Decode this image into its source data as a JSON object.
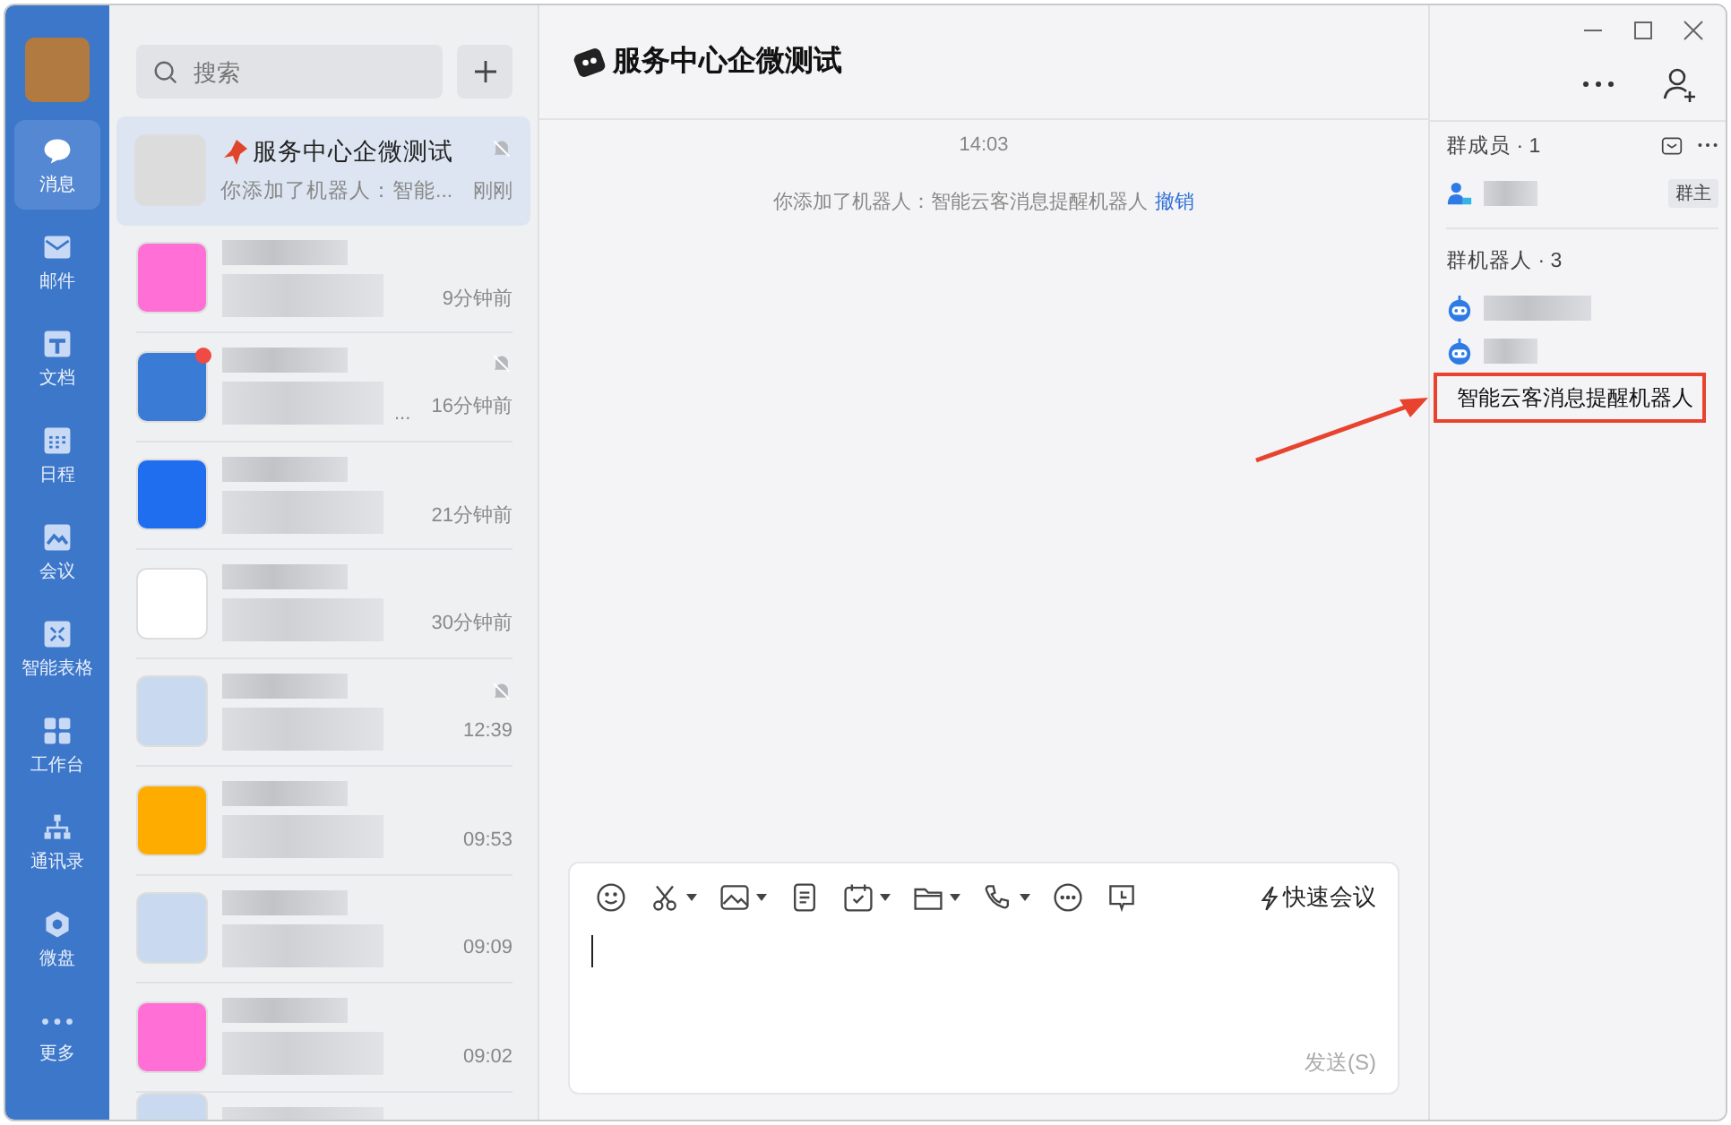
{
  "nav": [
    {
      "label": "消息",
      "selected": true
    },
    {
      "label": "邮件",
      "selected": false
    },
    {
      "label": "文档",
      "selected": false
    },
    {
      "label": "日程",
      "selected": false
    },
    {
      "label": "会议",
      "selected": false
    },
    {
      "label": "智能表格",
      "selected": false
    },
    {
      "label": "工作台",
      "selected": false
    },
    {
      "label": "通讯录",
      "selected": false
    },
    {
      "label": "微盘",
      "selected": false
    },
    {
      "label": "更多",
      "selected": false
    }
  ],
  "search": {
    "placeholder": "搜索"
  },
  "conversations": [
    {
      "title": "服务中心企微测试",
      "preview": "你添加了机器人：智能...",
      "time": "刚刚",
      "muted": true,
      "unread": false,
      "selected": true
    },
    {
      "time": "9分钟前",
      "muted": false,
      "unread": false,
      "selected": false
    },
    {
      "time": "16分钟前",
      "preview_tail": "...",
      "muted": true,
      "unread": true,
      "selected": false
    },
    {
      "time": "21分钟前",
      "muted": false,
      "unread": false,
      "selected": false
    },
    {
      "time": "30分钟前",
      "muted": false,
      "unread": false,
      "selected": false
    },
    {
      "time": "12:39",
      "muted": true,
      "unread": false,
      "selected": false
    },
    {
      "time": "09:53",
      "muted": false,
      "unread": false,
      "selected": false
    },
    {
      "time": "09:09",
      "muted": false,
      "unread": false,
      "selected": false
    },
    {
      "time": "09:02",
      "muted": false,
      "unread": false,
      "selected": false
    }
  ],
  "chat": {
    "title": "服务中心企微测试",
    "time": "14:03",
    "system_message": "你添加了机器人：智能云客消息提醒机器人",
    "undo_link": "撤销",
    "quick_meeting": "快速会议",
    "send": "发送(S)"
  },
  "members": {
    "heading": "群成员 · 1",
    "owner_badge": "群主"
  },
  "robots": {
    "heading": "群机器人 · 3",
    "items": [
      {
        "highlighted": false
      },
      {
        "highlighted": false
      },
      {
        "name": "智能云客消息提醒机器人",
        "highlighted": true
      }
    ]
  }
}
